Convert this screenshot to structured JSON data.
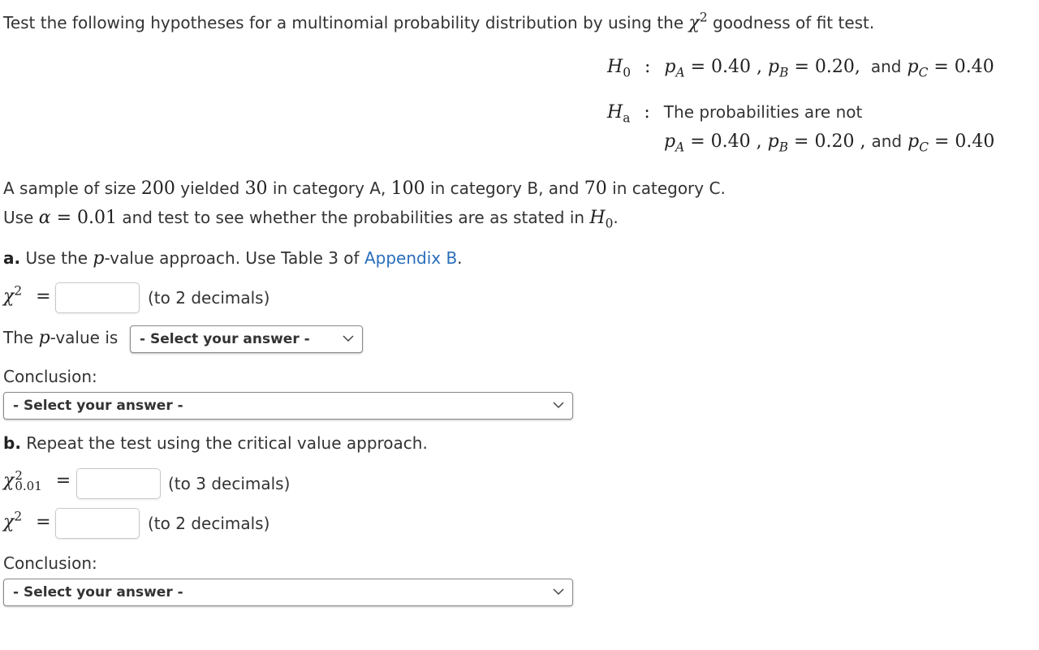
{
  "intro": {
    "text_before": "Test the following hypotheses for a multinomial probability distribution by using the",
    "chi_symbol": "χ",
    "chi_exp": "2",
    "text_after": "goodness of fit test."
  },
  "h0": {
    "label": "H",
    "label_sub": "0",
    "colon": ":",
    "pA_label": "p",
    "pA_sub": "A",
    "pA_value": "= 0.40",
    "sep1": ",",
    "pB_label": "p",
    "pB_sub": "B",
    "pB_value": "= 0.20,",
    "and": "and",
    "pC_label": "p",
    "pC_sub": "C",
    "pC_value": "= 0.40"
  },
  "ha": {
    "label": "H",
    "label_sub": "a",
    "colon": ":",
    "text": "The probabilities are not",
    "pA_label": "p",
    "pA_sub": "A",
    "pA_value": "= 0.40",
    "sep1": ",",
    "pB_label": "p",
    "pB_sub": "B",
    "pB_value": "= 0.20",
    "sep2": ",",
    "and": "and",
    "pC_label": "p",
    "pC_sub": "C",
    "pC_value": "= 0.40"
  },
  "sample": {
    "t1": "A sample of size",
    "n": "200",
    "t2": "yielded",
    "a": "30",
    "t3": "in category A,",
    "b": "100",
    "t4": "in category B, and",
    "c": "70",
    "t5": "in category C."
  },
  "alpha_line": {
    "t1": "Use",
    "alpha_sym": "α",
    "alpha_value": "= 0.01",
    "t2": "and test to see whether the probabilities are as stated in",
    "h": "H",
    "h_sub": "0",
    "end": "."
  },
  "part_a": {
    "letter": "a.",
    "t1": "Use the",
    "p": "p",
    "t2": "-value approach. Use Table 3 of",
    "link": "Appendix B",
    "end": ".",
    "chi_label": "χ",
    "chi_exp": "2",
    "equals": "=",
    "chi_input_value": "",
    "chi_hint": "(to 2 decimals)",
    "pvalue_t1": "The",
    "pvalue_p": "p",
    "pvalue_t2": "-value is",
    "pvalue_select": "- Select your answer -",
    "conclusion_label": "Conclusion:",
    "conclusion_select": "- Select your answer -"
  },
  "part_b": {
    "letter": "b.",
    "text": "Repeat the test using the critical value approach.",
    "crit_label": "χ",
    "crit_exp": "2",
    "crit_sub": "0.01",
    "equals": "=",
    "crit_input_value": "",
    "crit_hint": "(to 3 decimals)",
    "chi_label": "χ",
    "chi_exp": "2",
    "chi_input_value": "",
    "chi_hint": "(to 2 decimals)",
    "conclusion_label": "Conclusion:",
    "conclusion_select": "- Select your answer -"
  },
  "colors": {
    "link": "#2a6ebb",
    "text": "#333333"
  }
}
